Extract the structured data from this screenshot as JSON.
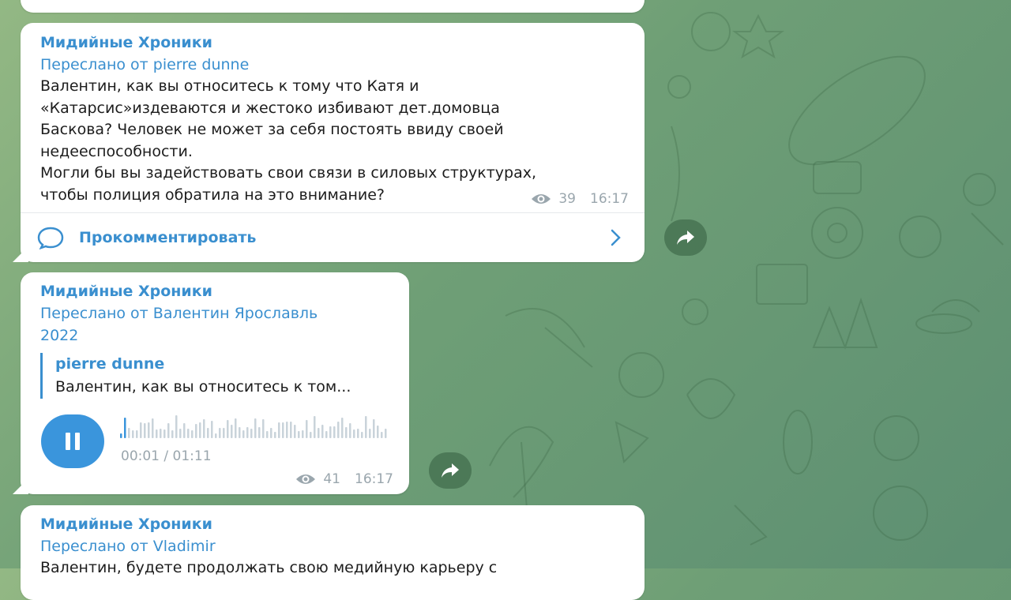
{
  "messages": [
    {
      "channel": "Мидийные Хроники",
      "forwarded": "Переслано от pierre dunne",
      "text_lines": [
        "Валентин, как вы относитесь к тому что Катя и",
        "«Катарсис»издеваются и жестоко избивают дет.домовца",
        "Баскова? Человек не может за себя постоять ввиду своей",
        "недееспособности.",
        "Могли бы вы задействовать свои связи в силовых структурах,",
        "чтобы полиция обратила на это внимание?"
      ],
      "views": "39",
      "time": "16:17",
      "comment_label": "Прокомментировать"
    },
    {
      "channel": "Мидийные Хроники",
      "forwarded_lines": [
        "Переслано от Валентин Ярославль",
        "2022"
      ],
      "reply_author": "pierre dunne",
      "reply_snippet": "Валентин, как вы относитесь к том...",
      "audio_time": "00:01 / 01:11",
      "views": "41",
      "time": "16:17"
    },
    {
      "channel": "Мидийные Хроники",
      "forwarded": "Переслано от Vladimir",
      "text_partial": "Валентин, будете продолжать свою медийную карьеру с"
    }
  ],
  "icons": {
    "eye": "eye-icon",
    "comment": "comment-bubble-icon",
    "chevron": "chevron-right-icon",
    "share": "share-arrow-icon",
    "pause": "pause-icon"
  },
  "colors": {
    "accent": "#3a8fcf",
    "play_button": "#3a95dc",
    "meta_text": "#9aa6ad"
  }
}
